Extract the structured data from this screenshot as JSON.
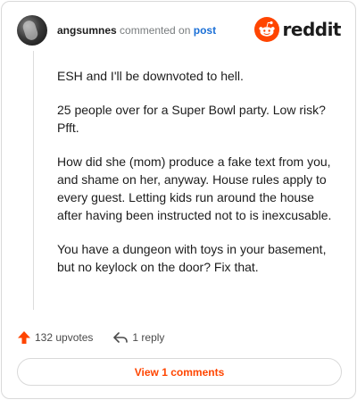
{
  "header": {
    "username": "angsumnes",
    "action_text": "commented on",
    "post_link": "post",
    "brand_name": "reddit"
  },
  "comment": {
    "paragraphs": [
      "ESH and I'll be downvoted to hell.",
      "25 people over for a Super Bowl party. Low risk? Pfft.",
      "How did she (mom) produce a fake text from you, and shame on her, anyway. House rules apply to every guest. Letting kids run around the house after having been instructed not to is inexcusable.",
      "You have a dungeon with toys in your basement, but no keylock on the door? Fix that."
    ]
  },
  "actions": {
    "upvotes_label": "132 upvotes",
    "reply_label": "1 reply",
    "upvote_icon": "arrow-up-icon",
    "reply_icon": "reply-arrow-icon"
  },
  "footer": {
    "view_comments_label": "View 1 comments"
  },
  "colors": {
    "brand_orange": "#ff4500",
    "link_blue": "#1a6fd6",
    "muted_text": "#787c7e"
  }
}
